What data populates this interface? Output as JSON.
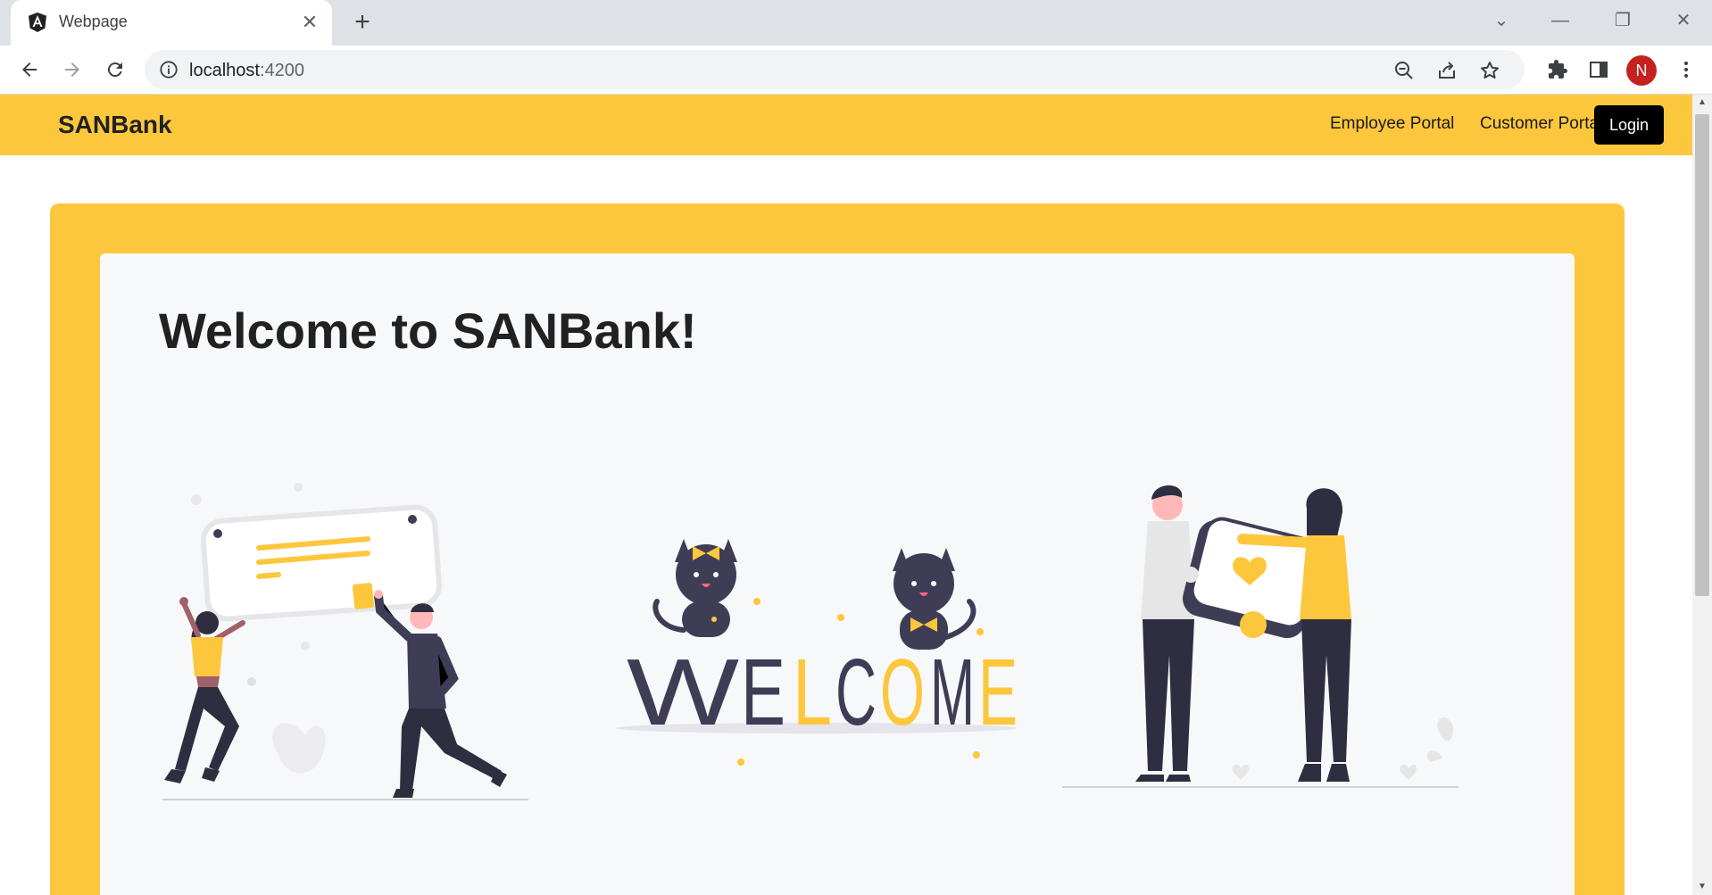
{
  "browser": {
    "tab_title": "Webpage",
    "url_host": "localhost",
    "url_port": ":4200",
    "profile_initial": "N"
  },
  "navbar": {
    "brand": "SANBank",
    "links": [
      "Employee Portal",
      "Customer Portal"
    ],
    "login_label": "Login"
  },
  "hero": {
    "title": "Welcome to SANBank!",
    "welcome_letters": [
      "W",
      "E",
      "L",
      "C",
      "O",
      "M",
      "E"
    ]
  },
  "colors": {
    "accent": "#fdc73d",
    "dark": "#3f3d56",
    "panel": "#f7f8fa"
  }
}
